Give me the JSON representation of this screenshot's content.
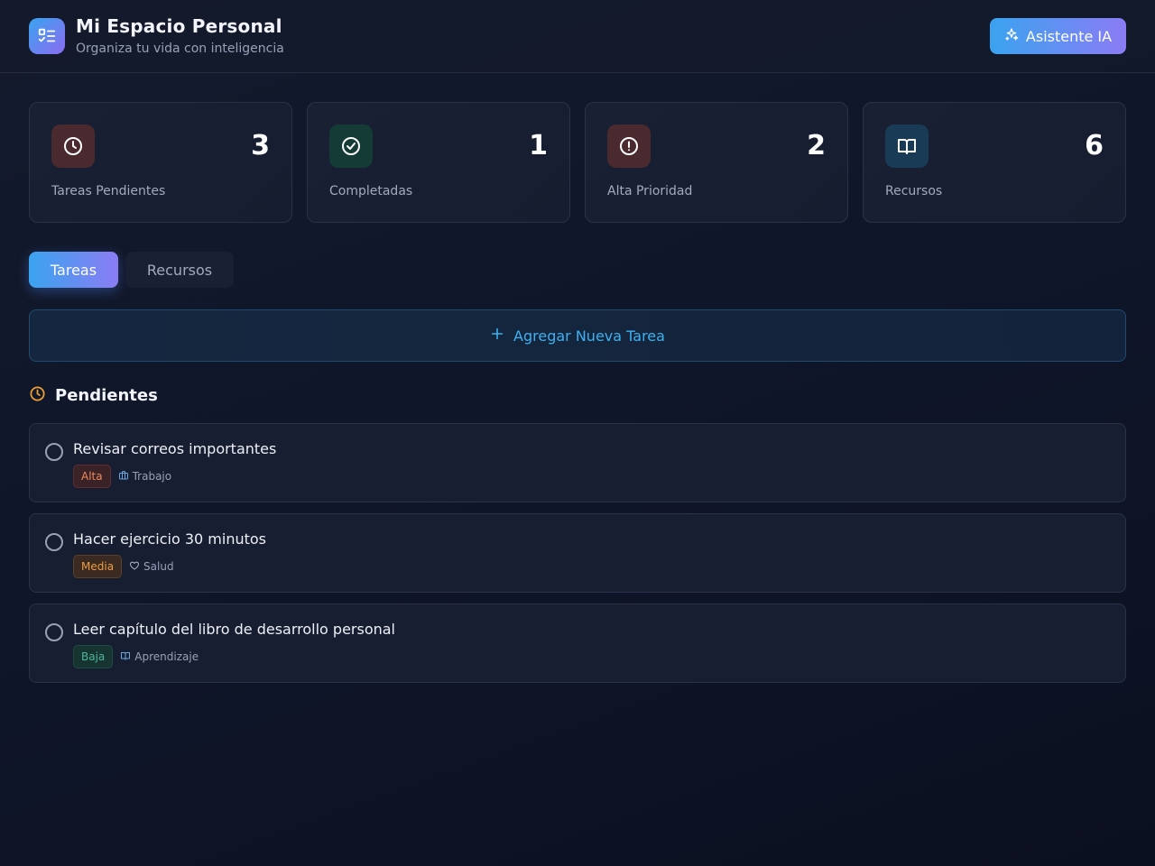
{
  "header": {
    "title": "Mi Espacio Personal",
    "subtitle": "Organiza tu vida con inteligencia",
    "ai_button": "Asistente IA",
    "logo_icon": "checklist-icon"
  },
  "stats": [
    {
      "label": "Tareas Pendientes",
      "value": "3",
      "icon": "clock-icon",
      "color": "#f06a6a"
    },
    {
      "label": "Completadas",
      "value": "1",
      "icon": "check-circle-icon",
      "color": "#3ecf9a"
    },
    {
      "label": "Alta Prioridad",
      "value": "2",
      "icon": "alert-circle-icon",
      "color": "#f06a6a"
    },
    {
      "label": "Recursos",
      "value": "6",
      "icon": "book-open-icon",
      "color": "#4fb3f0"
    }
  ],
  "tabs": [
    {
      "label": "Tareas",
      "active": true
    },
    {
      "label": "Recursos",
      "active": false
    }
  ],
  "add_task": {
    "label": "Agregar Nueva Tarea"
  },
  "section": {
    "title": "Pendientes",
    "icon": "clock-icon"
  },
  "tasks": [
    {
      "title": "Revisar correos importantes",
      "priority": "Alta",
      "category": "Trabajo",
      "category_icon": "briefcase-icon"
    },
    {
      "title": "Hacer ejercicio 30 minutos",
      "priority": "Media",
      "category": "Salud",
      "category_icon": "heart-icon"
    },
    {
      "title": "Leer capítulo del libro de desarrollo personal",
      "priority": "Baja",
      "category": "Aprendizaje",
      "category_icon": "book-open-icon"
    }
  ],
  "colors": {
    "accent_gradient_start": "#3aa3f0",
    "accent_gradient_end": "#8b7cf3",
    "background": "#10162a",
    "card": "#181e31"
  }
}
